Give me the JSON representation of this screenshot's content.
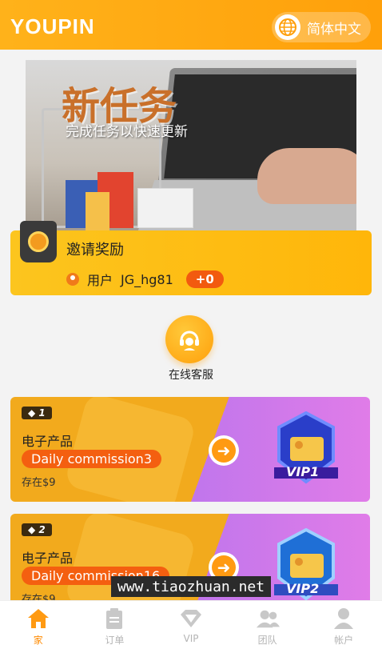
{
  "header": {
    "logo": "YOUPIN",
    "language": "简体中文"
  },
  "banner": {
    "title": "新任务",
    "subtitle": "完成任务以快速更新"
  },
  "invite": {
    "title": "邀请奖励",
    "user_label": "用户",
    "username": "JG_hg81",
    "badge": "+0"
  },
  "service": {
    "label": "在线客服"
  },
  "cards": [
    {
      "level": "1",
      "name": "电子产品",
      "commission": "Daily commission3",
      "deposit": "存在$9",
      "vip": "VIP1"
    },
    {
      "level": "2",
      "name": "电子产品",
      "commission": "Daily commission16",
      "deposit": "存在$9",
      "vip": "VIP2"
    }
  ],
  "watermark": "www.tiaozhuan.net",
  "tabs": [
    {
      "label": "家",
      "icon": "home-icon",
      "active": true
    },
    {
      "label": "订单",
      "icon": "orders-icon",
      "active": false
    },
    {
      "label": "VIP",
      "icon": "diamond-icon",
      "active": false
    },
    {
      "label": "团队",
      "icon": "team-icon",
      "active": false
    },
    {
      "label": "帐户",
      "icon": "account-icon",
      "active": false
    }
  ],
  "colors": {
    "accent": "#ffa00a",
    "badge": "#f45f10",
    "active_tab": "#ff8a00"
  }
}
